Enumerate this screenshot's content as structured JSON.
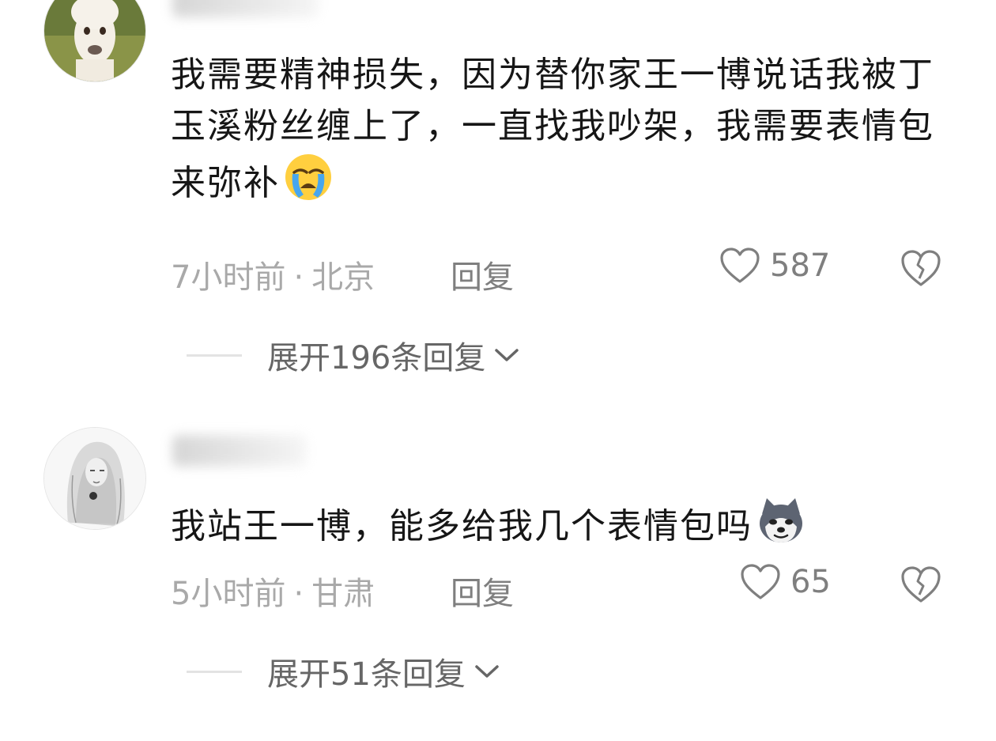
{
  "comments": [
    {
      "text": "我需要精神损失，因为替你家王一博说话我被丁玉溪粉丝缠上了，一直找我吵架，我需要表情包来弥补",
      "emoji": "crying-face-icon",
      "time": "7小时前",
      "separator": "·",
      "location": "北京",
      "reply_label": "回复",
      "likes": "587",
      "expand_label": "展开196条回复"
    },
    {
      "text": "我站王一博，能多给我几个表情包吗",
      "emoji": "husky-dog-icon",
      "time": "5小时前",
      "separator": "·",
      "location": "甘肃",
      "reply_label": "回复",
      "likes": "65",
      "expand_label": "展开51条回复"
    }
  ],
  "colors": {
    "text": "#161616",
    "meta": "#a9a9a9",
    "action": "#7f7f7f"
  }
}
